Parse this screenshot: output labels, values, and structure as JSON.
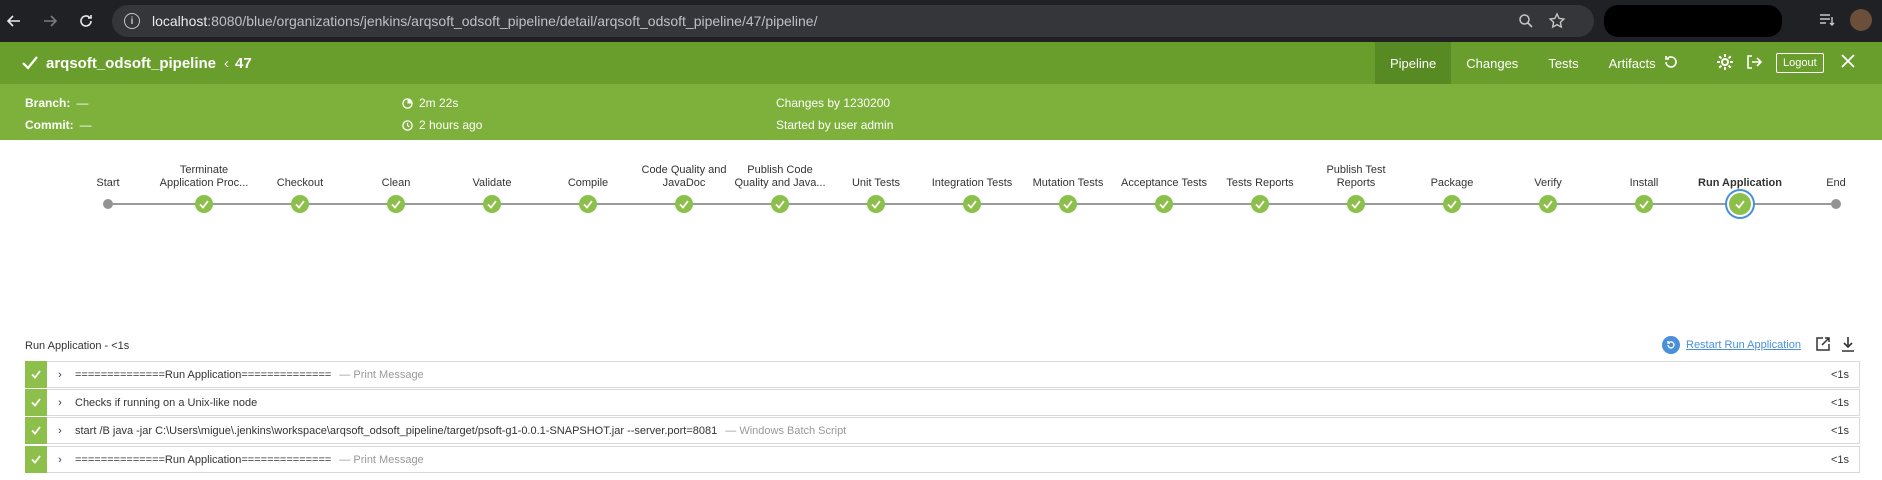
{
  "browser": {
    "url_host": "localhost",
    "url_rest": ":8080/blue/organizations/jenkins/arqsoft_odsoft_pipeline/detail/arqsoft_odsoft_pipeline/47/pipeline/"
  },
  "header": {
    "pipeline_name": "arqsoft_odsoft_pipeline",
    "run_number": "47",
    "tabs": [
      "Pipeline",
      "Changes",
      "Tests",
      "Artifacts"
    ],
    "active_tab": "Pipeline",
    "logout_label": "Logout",
    "accent_color": "#6a9e2c"
  },
  "summary": {
    "branch_label": "Branch:",
    "branch_value": "—",
    "commit_label": "Commit:",
    "commit_value": "—",
    "duration": "2m 22s",
    "started_ago": "2 hours ago",
    "changes": "Changes by 1230200",
    "started_by": "Started by user admin"
  },
  "stages": [
    {
      "label": "Start",
      "status": "start"
    },
    {
      "label": "Terminate Application Proc...",
      "status": "success"
    },
    {
      "label": "Checkout",
      "status": "success"
    },
    {
      "label": "Clean",
      "status": "success"
    },
    {
      "label": "Validate",
      "status": "success"
    },
    {
      "label": "Compile",
      "status": "success"
    },
    {
      "label": "Code Quality and JavaDoc",
      "status": "success"
    },
    {
      "label": "Publish Code Quality and Java...",
      "status": "success"
    },
    {
      "label": "Unit Tests",
      "status": "success"
    },
    {
      "label": "Integration Tests",
      "status": "success"
    },
    {
      "label": "Mutation Tests",
      "status": "success"
    },
    {
      "label": "Acceptance Tests",
      "status": "success"
    },
    {
      "label": "Tests Reports",
      "status": "success"
    },
    {
      "label": "Publish Test Reports",
      "status": "success"
    },
    {
      "label": "Package",
      "status": "success"
    },
    {
      "label": "Verify",
      "status": "success"
    },
    {
      "label": "Install",
      "status": "success"
    },
    {
      "label": "Run Application",
      "status": "selected"
    },
    {
      "label": "End",
      "status": "end"
    }
  ],
  "details": {
    "title": "Run Application - <1s",
    "restart_label": "Restart Run Application",
    "steps": [
      {
        "message": "==============Run Application==============",
        "kind": "— Print Message",
        "duration": "<1s"
      },
      {
        "message": "Checks if running on a Unix-like node",
        "kind": "",
        "duration": "<1s"
      },
      {
        "message": "start /B java -jar C:\\Users\\migue\\.jenkins\\workspace\\arqsoft_odsoft_pipeline/target/psoft-g1-0.0.1-SNAPSHOT.jar --server.port=8081",
        "kind": "— Windows Batch Script",
        "duration": "<1s"
      },
      {
        "message": "==============Run Application==============",
        "kind": "— Print Message",
        "duration": "<1s"
      }
    ]
  }
}
